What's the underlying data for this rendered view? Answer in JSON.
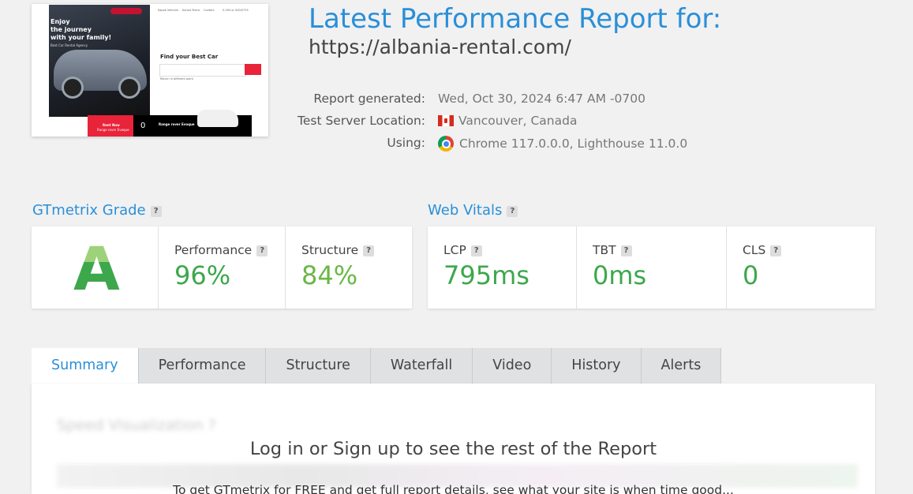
{
  "thumbnail": {
    "hero_line1": "Enjoy",
    "hero_line2": "the journey",
    "hero_line3": "with your family!",
    "hero_sub": "Best Car Rental Agency",
    "nav": [
      "Kapak Vehicles",
      "Kuhad Terms",
      "Contact",
      "0-000 or 000/0735"
    ],
    "find_title": "Find your Best Car",
    "checkbox_text": "Return in different point",
    "red_box_line1": "Rent Now",
    "red_box_line2": "Range rover Evoque",
    "black_box_price": "0",
    "black_box_title": "Range rover Evoque"
  },
  "report": {
    "title": "Latest Performance Report for:",
    "url": "https://albania-rental.com/",
    "generated_label": "Report generated:",
    "generated_value": "Wed, Oct 30, 2024 6:47 AM -0700",
    "location_label": "Test Server Location:",
    "location_value": "Vancouver, Canada",
    "using_label": "Using:",
    "using_value": "Chrome 117.0.0.0, Lighthouse 11.0.0"
  },
  "grade": {
    "section_title": "GTmetrix Grade",
    "help": "?",
    "letter": "A",
    "performance_label": "Performance",
    "performance_value": "96%",
    "structure_label": "Structure",
    "structure_value": "84%"
  },
  "vitals": {
    "section_title": "Web Vitals",
    "help": "?",
    "lcp_label": "LCP",
    "lcp_value": "795ms",
    "tbt_label": "TBT",
    "tbt_value": "0ms",
    "cls_label": "CLS",
    "cls_value": "0"
  },
  "tabs": [
    {
      "label": "Summary"
    },
    {
      "label": "Performance"
    },
    {
      "label": "Structure"
    },
    {
      "label": "Waterfall"
    },
    {
      "label": "Video"
    },
    {
      "label": "History"
    },
    {
      "label": "Alerts"
    }
  ],
  "panel": {
    "blurred_heading": "Speed Visualization ?",
    "login_prompt": "Log in or Sign up to see the rest of the Report",
    "login_subtext": "To get GTmetrix for FREE and get full report details, see what your site is when time good..."
  },
  "colors": {
    "accent": "#2a8fd8",
    "good": "#3da74c",
    "active_tab_text": "#2a8fd8",
    "tab_bg": "#dfe1e3"
  }
}
